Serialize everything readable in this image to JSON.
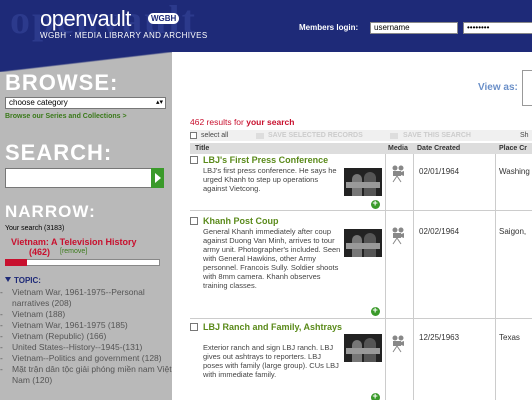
{
  "header": {
    "watermark": "openvault",
    "logo_text": "openvault",
    "logo_badge": "WGBH",
    "tagline": "WGBH · MEDIA LIBRARY AND ARCHIVES",
    "members_login_label": "Members login:",
    "username_value": "username",
    "password_value": "••••••••"
  },
  "sidebar": {
    "browse_title": "BROWSE:",
    "category_select": "choose category",
    "series_link": "Browse our Series and Collections >",
    "search_title": "SEARCH:",
    "narrow_title": "NARROW:",
    "your_search": "Your search (3183)",
    "filter_label": "Vietnam: A Television History",
    "filter_count": "(462)",
    "filter_remove": "[remove]",
    "filter_fraction": 0.145,
    "topic_title": "TOPIC:",
    "topics": [
      "Vietnam War, 1961-1975--Personal narratives (208)",
      "Vietnam (188)",
      "Vietnam War, 1961-1975 (185)",
      "Vietnam (Republic) (166)",
      "United States--History--1945-(131)",
      "Vietnam--Politics and government (128)",
      "Mặt trận dân tộc giải phóng miền nam Việt Nam (120)"
    ]
  },
  "main": {
    "view_as": "View as:",
    "results_count": "462 results for",
    "results_query": "your search",
    "select_all": "select all",
    "save_selected": "SAVE SELECTED RECORDS",
    "save_search": "SAVE THIS SEARCH",
    "share": "Sh",
    "columns": [
      "Title",
      "Media",
      "Date Created",
      "Place Cr"
    ],
    "rows": [
      {
        "title": "LBJ's First Press Conference",
        "desc": "LBJ's first press conference. He says he urged Khanh to step up operations against Vietcong.",
        "date": "02/01/1964",
        "place": "Washing"
      },
      {
        "title": "Khanh Post Coup",
        "desc": "General Khanh immediately after coup against Duong Van Minh, arrives to tour army unit. Photographer's included. Seen with General Hawkins, other Army personnel. Francois Sully. Soldier shoots with 8mm camera. Khanh observes training classes.",
        "date": "02/02/1964",
        "place": "Saigon,"
      },
      {
        "title": "LBJ Ranch and Family, Ashtrays",
        "desc": "Exterior ranch and sign LBJ ranch. LBJ gives out ashtrays to reporters. LBJ poses with family (large group). CUs LBJ with immediate family.",
        "date": "12/25/1963",
        "place": "Texas"
      }
    ]
  }
}
